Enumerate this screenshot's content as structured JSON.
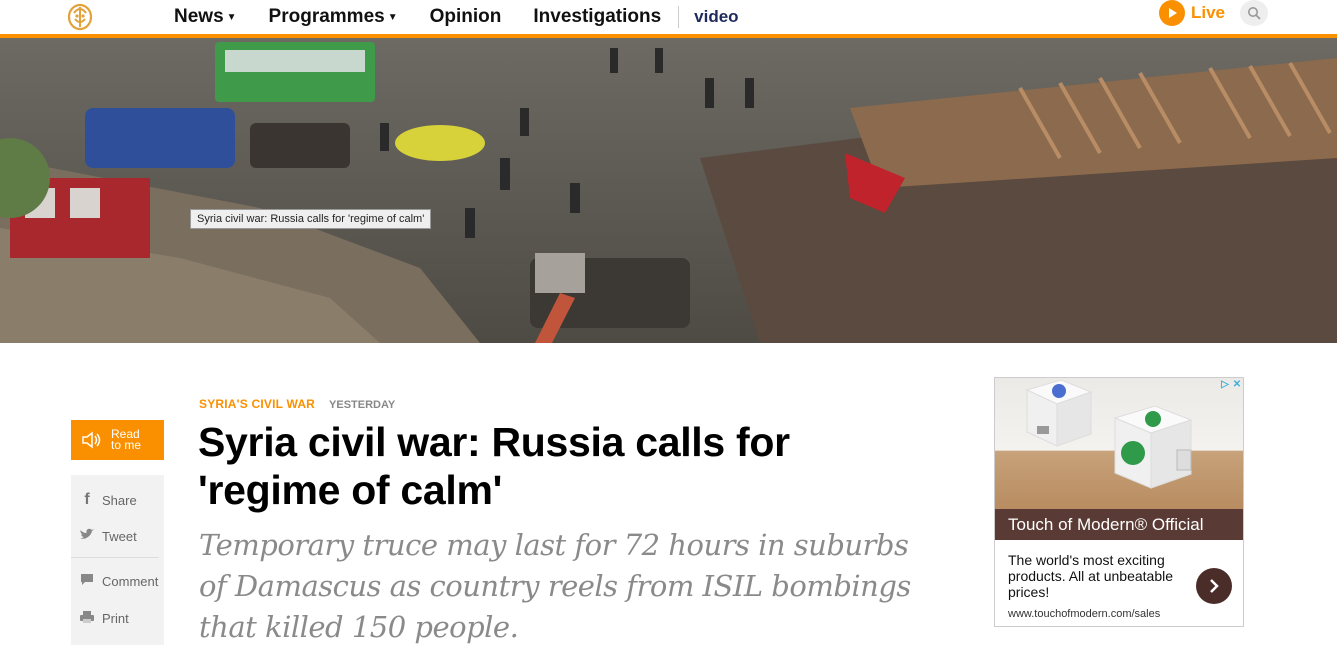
{
  "header": {
    "nav": [
      {
        "label": "News",
        "dropdown": true
      },
      {
        "label": "Programmes",
        "dropdown": true
      },
      {
        "label": "Opinion",
        "dropdown": false
      },
      {
        "label": "Investigations",
        "dropdown": false
      }
    ],
    "video_label": "video",
    "live_label": "Live",
    "accent_color": "#fa9000"
  },
  "hero": {
    "image_alt": "Syria civil war: Russia calls for 'regime of calm'",
    "tooltip": "Syria civil war: Russia calls for 'regime of calm'"
  },
  "share": {
    "read_line1": "Read",
    "read_line2": "to me",
    "items": [
      {
        "label": "Share",
        "icon": "facebook-icon"
      },
      {
        "label": "Tweet",
        "icon": "twitter-icon"
      },
      {
        "label": "Comment",
        "icon": "comment-icon"
      },
      {
        "label": "Print",
        "icon": "print-icon"
      }
    ]
  },
  "article": {
    "topic": "SYRIA'S CIVIL WAR",
    "date": "YESTERDAY",
    "headline": "Syria civil war: Russia calls for 'regime of calm'",
    "standfirst": "Temporary truce may last for 72 hours in suburbs of Damascus as country reels from ISIL bombings that killed 150 people."
  },
  "ad": {
    "brand": "Touch of Modern® Official",
    "copy": "The world's most exciting products. All at unbeatable prices!",
    "url": "www.touchofmodern.com/sales"
  }
}
